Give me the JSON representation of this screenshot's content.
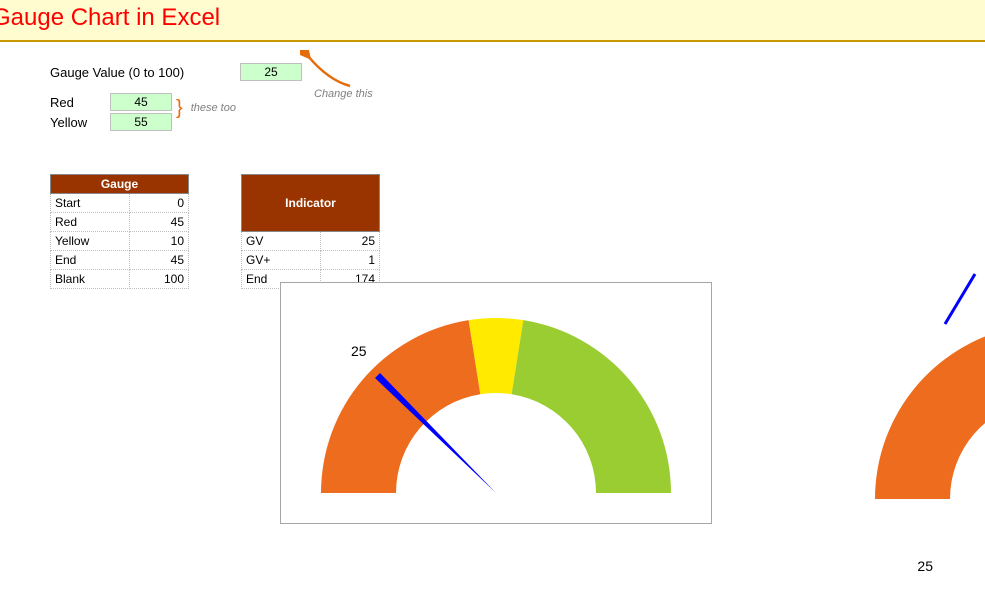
{
  "title": "Gauge Chart in Excel",
  "inputs": {
    "gauge_value_label": "Gauge Value (0 to 100)",
    "gauge_value": "25",
    "red_label": "Red",
    "red_value": "45",
    "yellow_label": "Yellow",
    "yellow_value": "55",
    "hint_change": "Change this",
    "hint_these": "these too"
  },
  "tables": {
    "gauge": {
      "header": "Gauge",
      "rows": [
        {
          "k": "Start",
          "v": "0"
        },
        {
          "k": "Red",
          "v": "45"
        },
        {
          "k": "Yellow",
          "v": "10"
        },
        {
          "k": "End",
          "v": "45"
        },
        {
          "k": "Blank",
          "v": "100"
        }
      ]
    },
    "indicator": {
      "header": "Indicator",
      "rows": [
        {
          "k": "GV",
          "v": "25"
        },
        {
          "k": "GV+",
          "v": "1"
        },
        {
          "k": "End",
          "v": "174"
        }
      ]
    }
  },
  "gauge_needle_label": "25",
  "partial_needle_label": "25",
  "chart_data": {
    "type": "pie",
    "title": "Gauge Chart in Excel",
    "description": "Semi-circular gauge built from a donut chart (upper half drawn, lower half blank) with an overlaid indicator needle.",
    "gauge_segments": [
      {
        "name": "Start",
        "value": 0,
        "color": null
      },
      {
        "name": "Red",
        "value": 45,
        "color": "#ed6c1e"
      },
      {
        "name": "Yellow",
        "value": 10,
        "color": "#ffea00"
      },
      {
        "name": "End",
        "value": 45,
        "color": "#9acd32"
      },
      {
        "name": "Blank",
        "value": 100,
        "color": "transparent"
      }
    ],
    "indicator_segments": [
      {
        "name": "GV",
        "value": 25,
        "color": "transparent"
      },
      {
        "name": "GV+",
        "value": 1,
        "color": "#0000ff"
      },
      {
        "name": "End",
        "value": 174,
        "color": "transparent"
      }
    ],
    "gauge_value": 25,
    "range": [
      0,
      100
    ],
    "needle_label": "25"
  }
}
